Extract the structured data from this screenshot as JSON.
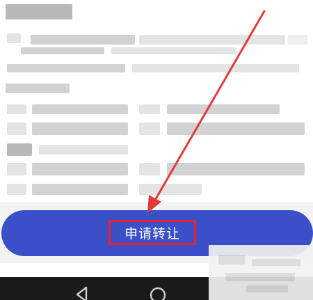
{
  "primary_button": {
    "label": "申请转让"
  },
  "colors": {
    "button": "#3b4fc8",
    "highlight": "#e8202a",
    "arrow": "#e23a3a",
    "navbar": "#1a1a1a"
  },
  "navbar": {
    "icons": [
      "back-icon",
      "home-icon"
    ]
  }
}
